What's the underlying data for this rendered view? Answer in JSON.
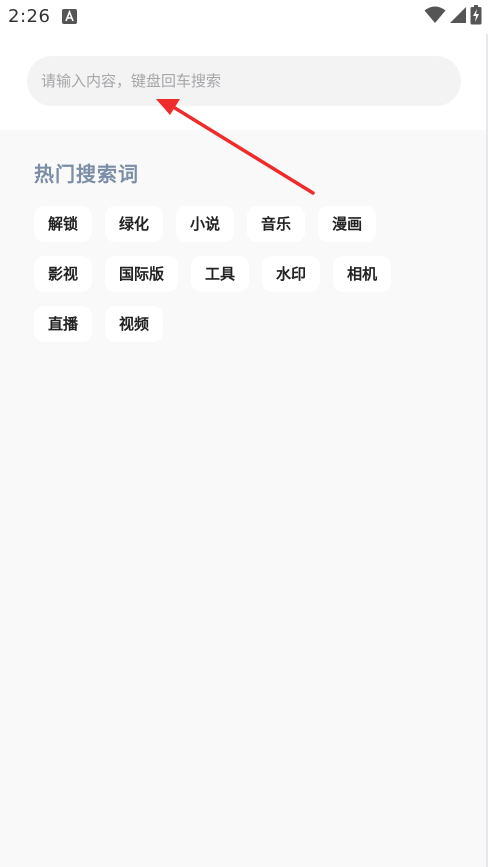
{
  "status_bar": {
    "time": "2:26",
    "notification_icon": "autofill-a-icon",
    "wifi_icon": "wifi-icon",
    "signal_icon": "cell-signal-icon",
    "battery_icon": "battery-charging-icon"
  },
  "search": {
    "placeholder": "请输入内容，键盘回车搜索",
    "value": ""
  },
  "hot": {
    "title": "热门搜索词",
    "rows": [
      [
        "解锁",
        "绿化",
        "小说",
        "音乐",
        "漫画"
      ],
      [
        "影视",
        "国际版",
        "工具",
        "水印",
        "相机"
      ],
      [
        "直播",
        "视频"
      ]
    ]
  },
  "annotation": {
    "arrow_color": "#f02b2b"
  }
}
